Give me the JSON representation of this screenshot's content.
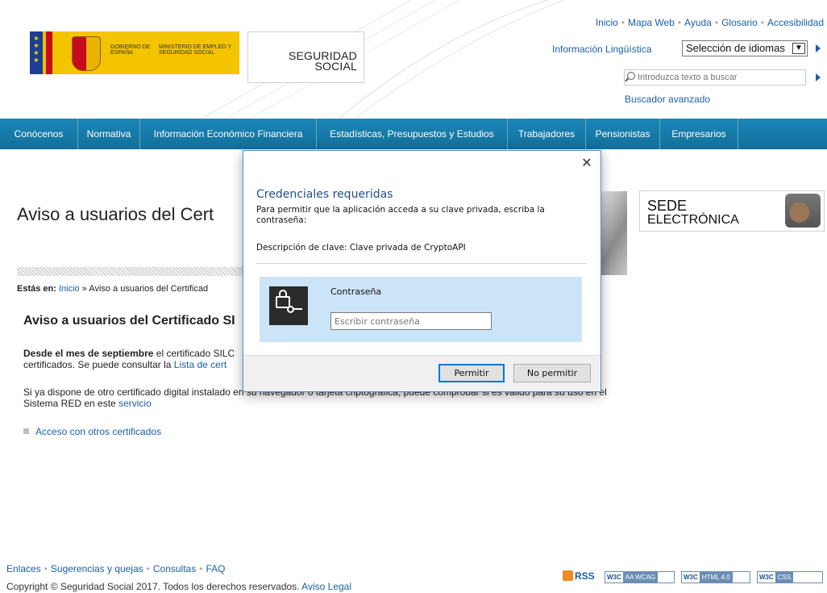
{
  "header": {
    "gov_line1": "GOBIERNO DE ESPAÑA",
    "gov_line2": "MINISTERIO DE EMPLEO Y SEGURIDAD SOCIAL",
    "logo_line1": "SEGURIDAD",
    "logo_line2": "SOCIAL",
    "top_links": [
      "Inicio",
      "Mapa Web",
      "Ayuda",
      "Glosario",
      "Accesibilidad"
    ],
    "info_linguistica": "Información Lingüística",
    "language_select": "Selección de idiomas",
    "search_placeholder": "Introduzca texto a buscar",
    "advanced_search": "Buscador avanzado"
  },
  "nav": {
    "items": [
      "Conócenos",
      "Normativa",
      "Información Económico Financiera",
      "Estadísticas, Presupuestos y Estudios",
      "Trabajadores",
      "Pensionistas",
      "Empresarios"
    ]
  },
  "main": {
    "heading": "Aviso a usuarios del Cert",
    "sede_line1": "SEDE",
    "sede_line2": "ELECTRÓNICA",
    "breadcrumb_prefix": "Estás en:",
    "breadcrumb_link": "Inicio",
    "breadcrumb_rest": "» Aviso a usuarios del Certificad",
    "section_title": "Aviso a usuarios del Certificado SI",
    "para1_bold": "Desde el mes de septiembre",
    "para1_text": "el certificado SILC",
    "para1_line2": "certificados. Se puede consultar la",
    "para1_link": "Lista de cert",
    "para2_text": "Si ya dispone de otro certificado digital instalado en su navegador o tarjeta criptográfica, puede comprobar si es válido para su uso en el Sistema RED en este",
    "para2_link": "servicio",
    "other_certs": "Acceso con otros certificados"
  },
  "footer": {
    "links": [
      "Enlaces",
      "Sugerencias y quejas",
      "Consultas",
      "FAQ"
    ],
    "copyright": "Copyright © Seguridad Social 2017. Todos los derechos reservados.",
    "legal": "Aviso Legal",
    "rss": "RSS",
    "badges": [
      {
        "w3c": "W3C",
        "label": "AA WCAG"
      },
      {
        "w3c": "W3C",
        "label": "HTML 4.0"
      },
      {
        "w3c": "W3C",
        "label": "CSS"
      }
    ]
  },
  "dialog": {
    "close": "✕",
    "title": "Credenciales requeridas",
    "description": "Para permitir que la aplicación acceda a su clave privada, escriba la contraseña:",
    "key_description": "Descripción de clave: Clave privada de CryptoAPI",
    "password_label": "Contraseña",
    "password_placeholder": "Escribir contraseña",
    "allow": "Permitir",
    "deny": "No permitir"
  },
  "colors": {
    "nav_bg": "#1a87b8",
    "link": "#1a5fa8",
    "dialog_panel": "#cce4f7",
    "gov_yellow": "#f4c400"
  }
}
